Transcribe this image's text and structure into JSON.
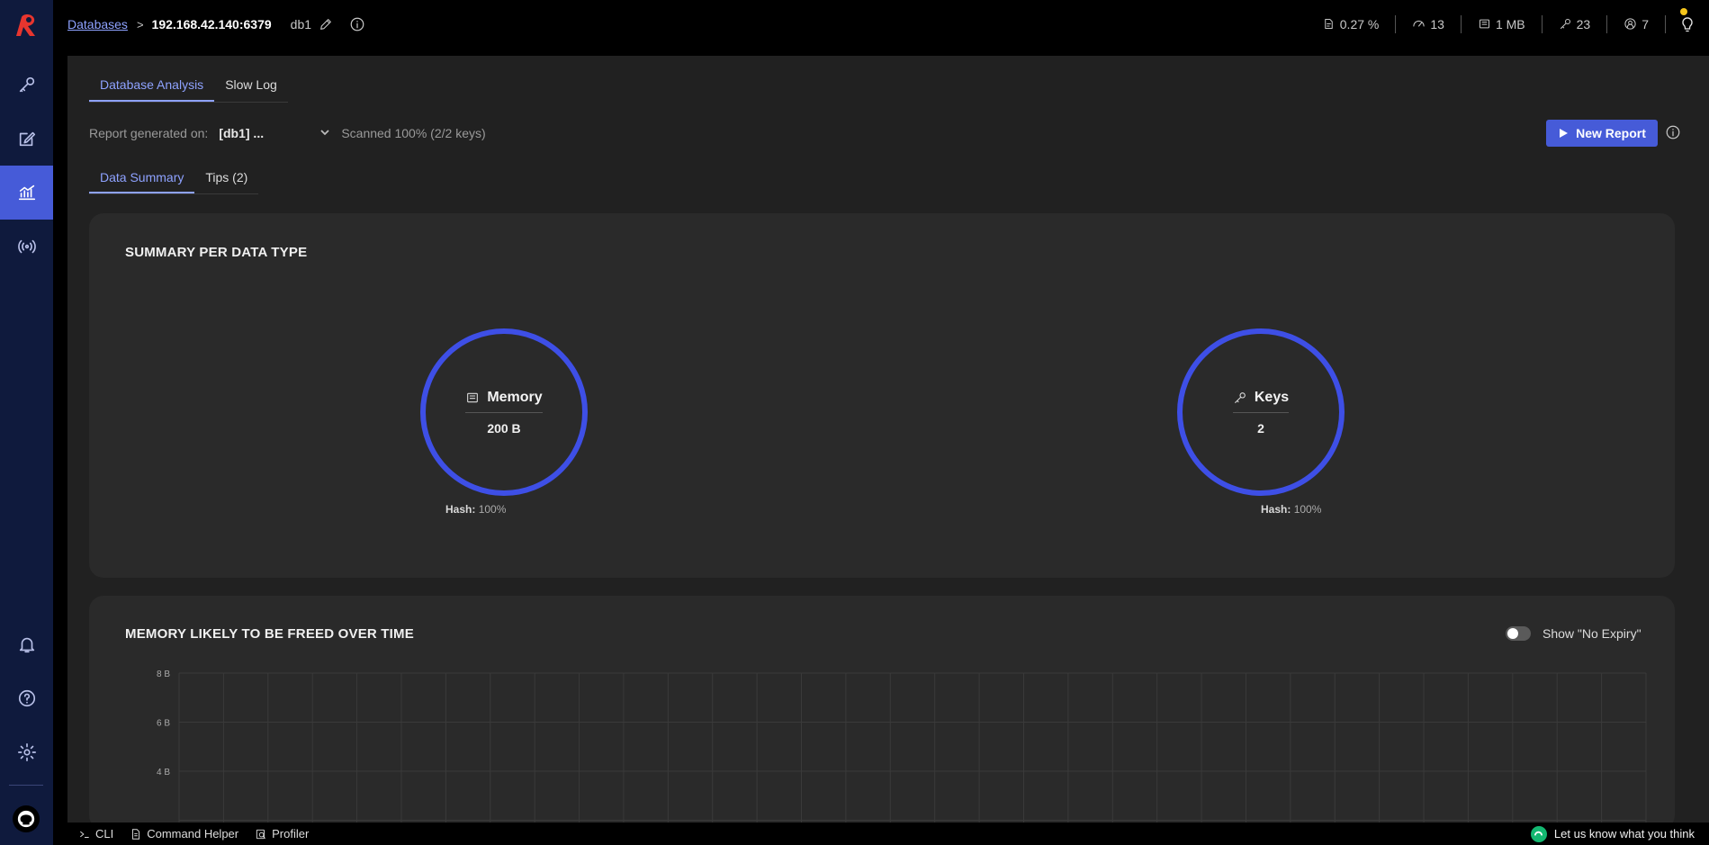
{
  "colors": {
    "accent": "#465bd8",
    "circle_border": "#3e4fe6",
    "link": "#8ea2ff",
    "sidebar_bg": "#0f1a3d"
  },
  "sidebar": {
    "items": [
      {
        "name": "browser",
        "icon": "key-icon"
      },
      {
        "name": "workbench",
        "icon": "edit-icon"
      },
      {
        "name": "analysis",
        "icon": "chart-icon",
        "active": true
      },
      {
        "name": "pubsub",
        "icon": "broadcast-icon"
      }
    ],
    "bottom": [
      {
        "name": "notifications",
        "icon": "bell-icon"
      },
      {
        "name": "help",
        "icon": "help-icon"
      },
      {
        "name": "settings",
        "icon": "gear-icon"
      },
      {
        "name": "github",
        "icon": "github-icon"
      }
    ]
  },
  "header": {
    "breadcrumb_link": "Databases",
    "breadcrumb_sep": ">",
    "host": "192.168.42.140:6379",
    "db_name": "db1",
    "stats": {
      "cpu": "0.27 %",
      "ops": "13",
      "memory": "1 MB",
      "keys": "23",
      "clients": "7"
    }
  },
  "main": {
    "tabs": [
      {
        "label": "Database Analysis",
        "active": true
      },
      {
        "label": "Slow Log"
      }
    ],
    "report_label": "Report generated on:",
    "report_value": "[db1] ...",
    "scanned": "Scanned 100% (2/2 keys)",
    "new_report_label": "New Report",
    "subtabs": [
      {
        "label": "Data Summary",
        "active": true
      },
      {
        "label": "Tips (2)"
      }
    ]
  },
  "summary": {
    "title": "SUMMARY PER DATA TYPE",
    "memory": {
      "label": "Memory",
      "value": "200 B",
      "legend_type": "Hash:",
      "legend_pct": "100%"
    },
    "keys": {
      "label": "Keys",
      "value": "2",
      "legend_type": "Hash:",
      "legend_pct": "100%"
    }
  },
  "expiry": {
    "title": "MEMORY LIKELY TO BE FREED OVER TIME",
    "toggle_label": "Show \"No Expiry\"",
    "toggle_on": false
  },
  "chart_data": {
    "type": "bar",
    "title": "MEMORY LIKELY TO BE FREED OVER TIME",
    "y_tick_labels": [
      "8 B",
      "6 B",
      "4 B"
    ],
    "ylim": [
      0,
      8
    ],
    "grid": true,
    "series": []
  },
  "footer": {
    "cli": "CLI",
    "command_helper": "Command Helper",
    "profiler": "Profiler",
    "feedback": "Let us know what you think"
  }
}
